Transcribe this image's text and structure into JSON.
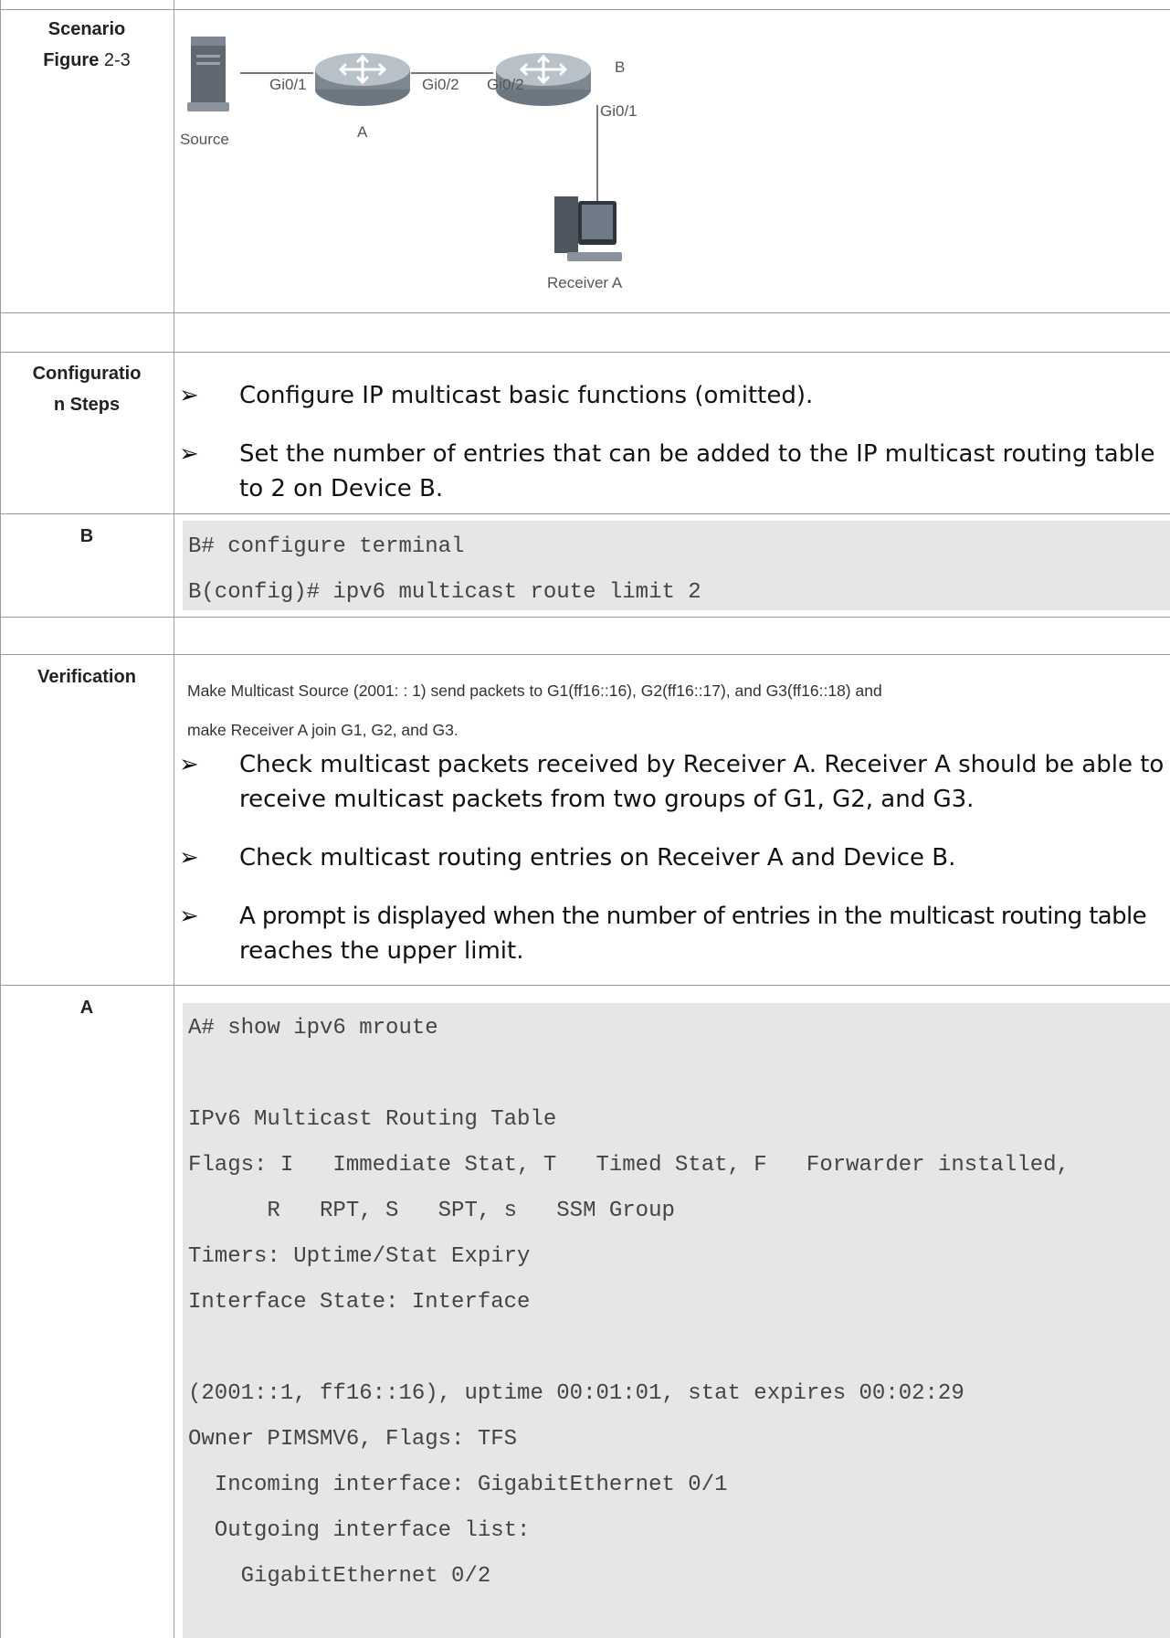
{
  "rows": {
    "scenario": {
      "label_bold": "Scenario",
      "label_figure_bold": "Figure",
      "label_figure_num": " 2-3"
    },
    "diagram": {
      "source_label": "Source",
      "router_a_label": "A",
      "router_b_label": "B",
      "receiver_label": "Receiver A",
      "a_port_left": "Gi0/1",
      "a_port_right": "Gi0/2",
      "b_port_left": "Gi0/2",
      "b_port_down": "Gi0/1"
    },
    "config_steps": {
      "label_line1": "Configuratio",
      "label_line2": "n Steps",
      "bullets": [
        "Configure IP multicast basic functions (omitted).",
        "Set the number of entries that can be added to the IP multicast routing table",
        "to 2 on Device B."
      ]
    },
    "b_config": {
      "label": "B",
      "lines": [
        "B# configure terminal",
        "B(config)# ipv6 multicast route limit 2"
      ]
    },
    "verification": {
      "label": "Verification",
      "intro_line1": "Make Multicast Source (2001: : 1) send packets to G1(ff16::16), G2(ff16::17), and G3(ff16::18) and",
      "intro_line2": "make Receiver A join G1, G2, and G3.",
      "bullets": [
        "Check multicast packets received by Receiver A. Receiver A should be able to",
        "receive multicast packets from two groups of G1, G2, and G3.",
        "Check multicast routing entries on Receiver A and Device B.",
        "A prompt is displayed when the number of entries in the multicast routing table",
        "reaches the upper limit."
      ]
    },
    "a_output": {
      "label": "A",
      "lines": [
        "A# show ipv6 mroute",
        "",
        "IPv6 Multicast Routing Table",
        "Flags: I   Immediate Stat, T   Timed Stat, F   Forwarder installed,",
        "      R   RPT, S   SPT, s   SSM Group",
        "Timers: Uptime/Stat Expiry",
        "Interface State: Interface",
        "",
        "(2001::1, ff16::16), uptime 00:01:01, stat expires 00:02:29",
        "Owner PIMSMV6, Flags: TFS",
        "  Incoming interface: GigabitEthernet 0/1",
        "  Outgoing interface list:",
        "    GigabitEthernet 0/2"
      ]
    }
  },
  "bullet_symbol": "➢"
}
